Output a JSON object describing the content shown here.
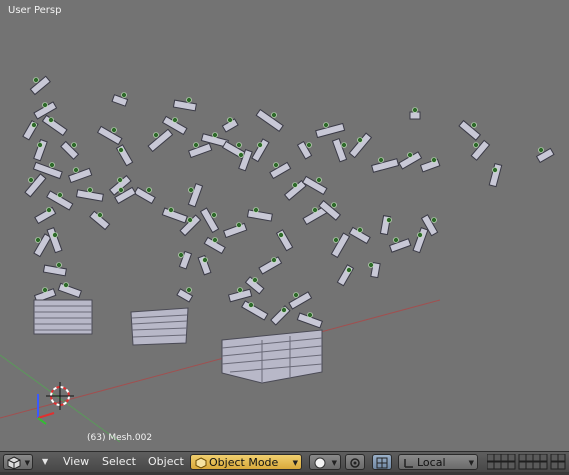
{
  "viewport": {
    "title": "User Persp",
    "status": "(63) Mesh.002",
    "background": "#737373"
  },
  "header": {
    "menus": [
      {
        "label": "View"
      },
      {
        "label": "Select"
      },
      {
        "label": "Object"
      }
    ],
    "mode": {
      "label": "Object Mode",
      "icon": "cube-icon"
    },
    "pivot": {
      "icon": "sphere-shading-icon"
    },
    "transform_orientation": {
      "label": "Local"
    },
    "layers_icon": "layers-grid-icon",
    "editor_icon": "3d-view-icon"
  }
}
